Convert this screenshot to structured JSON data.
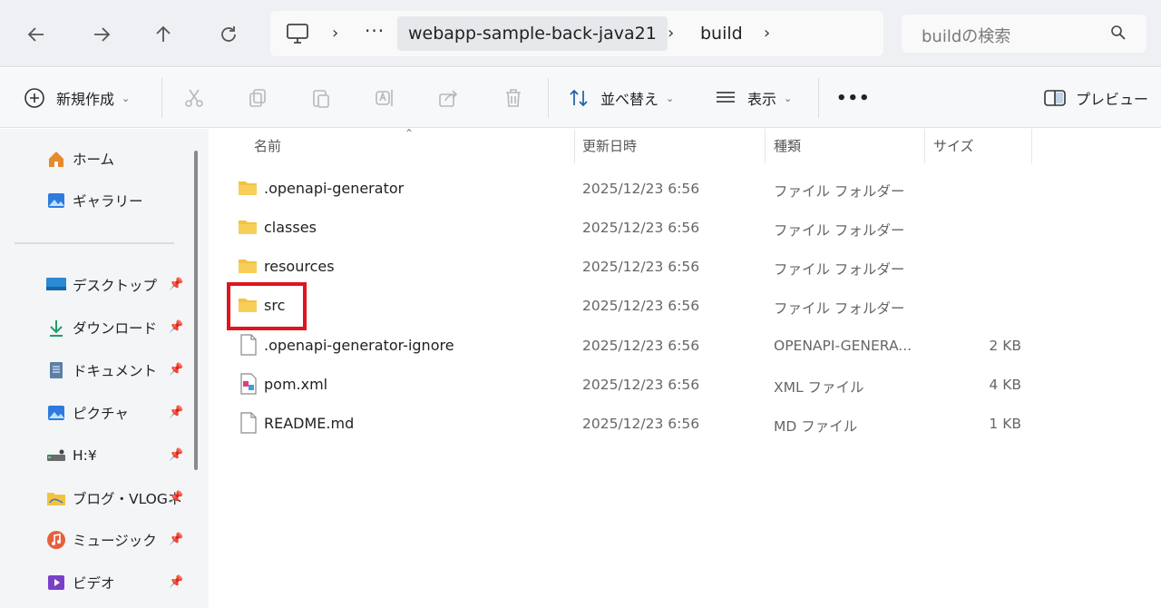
{
  "addressbar": {
    "back_icon": "arrow-left",
    "forward_icon": "arrow-right",
    "up_icon": "arrow-up",
    "refresh_icon": "refresh",
    "ellipsis": "···",
    "sep": "›",
    "path": [
      "webapp-sample-back-java21",
      "build"
    ],
    "search_placeholder": "buildの検索"
  },
  "toolbar": {
    "new_label": "新規作成",
    "sort_label": "並べ替え",
    "view_label": "表示",
    "more_label": "•••",
    "preview_label": "プレビュー"
  },
  "sidebar": {
    "top_items": [
      {
        "label": "ホーム",
        "icon": "home-icon"
      },
      {
        "label": "ギャラリー",
        "icon": "gallery-icon"
      }
    ],
    "pinned_items": [
      {
        "label": "デスクトップ",
        "icon": "desktop-icon"
      },
      {
        "label": "ダウンロード",
        "icon": "download-icon"
      },
      {
        "label": "ドキュメント",
        "icon": "document-icon"
      },
      {
        "label": "ピクチャ",
        "icon": "pictures-icon"
      },
      {
        "label": "H:¥",
        "icon": "drive-icon"
      },
      {
        "label": "ブログ・VLOGネ",
        "icon": "folder-icon"
      },
      {
        "label": "ミュージック",
        "icon": "music-icon"
      },
      {
        "label": "ビデオ",
        "icon": "video-icon"
      }
    ]
  },
  "columns": {
    "name": "名前",
    "date": "更新日時",
    "type": "種類",
    "size": "サイズ"
  },
  "files": [
    {
      "name": ".openapi-generator",
      "date": "2025/12/23 6:56",
      "type": "ファイル フォルダー",
      "size": "",
      "icon": "folder-icon"
    },
    {
      "name": "classes",
      "date": "2025/12/23 6:56",
      "type": "ファイル フォルダー",
      "size": "",
      "icon": "folder-icon"
    },
    {
      "name": "resources",
      "date": "2025/12/23 6:56",
      "type": "ファイル フォルダー",
      "size": "",
      "icon": "folder-icon"
    },
    {
      "name": "src",
      "date": "2025/12/23 6:56",
      "type": "ファイル フォルダー",
      "size": "",
      "icon": "folder-icon"
    },
    {
      "name": ".openapi-generator-ignore",
      "date": "2025/12/23 6:56",
      "type": "OPENAPI-GENERA...",
      "size": "2 KB",
      "icon": "file-icon"
    },
    {
      "name": "pom.xml",
      "date": "2025/12/23 6:56",
      "type": "XML ファイル",
      "size": "4 KB",
      "icon": "xml-file-icon"
    },
    {
      "name": "README.md",
      "date": "2025/12/23 6:56",
      "type": "MD ファイル",
      "size": "1 KB",
      "icon": "file-icon"
    }
  ],
  "colors": {
    "highlight": "#e0141e",
    "folder": "#f3c240",
    "accent": "#0067c0"
  }
}
